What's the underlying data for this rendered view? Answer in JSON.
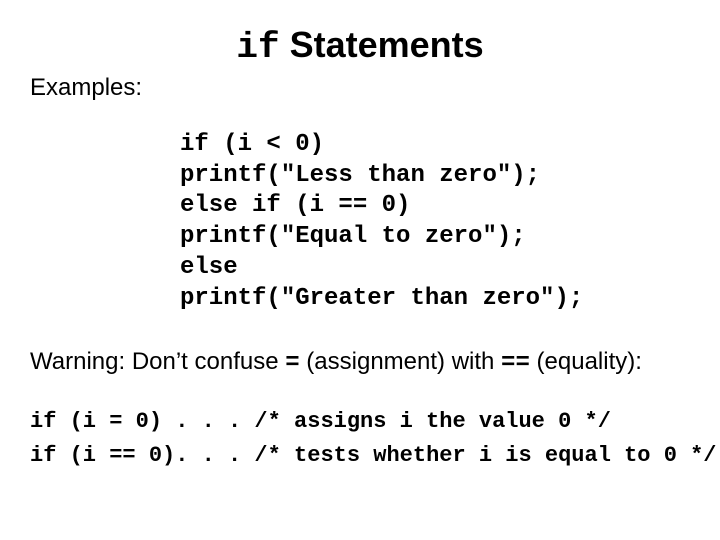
{
  "title": {
    "mono": "if",
    "rest": " Statements"
  },
  "examples_label": "Examples:",
  "code": {
    "l1": "if (i < 0)",
    "l2": "printf(\"Less than zero\");",
    "l3": "else if (i == 0)",
    "l4": "printf(\"Equal to zero\");",
    "l5": "else",
    "l6": "printf(\"Greater than zero\");"
  },
  "warning": {
    "pre": "Warning: Don’t confuse ",
    "eq1": "=",
    "mid1": " (assignment) with ",
    "eq2": "==",
    "post": " (equality):"
  },
  "bottom": {
    "l1": "if (i = 0) . . . /* assigns i the value 0 */",
    "l2": "if (i == 0). . . /* tests whether i is equal to 0 */"
  }
}
